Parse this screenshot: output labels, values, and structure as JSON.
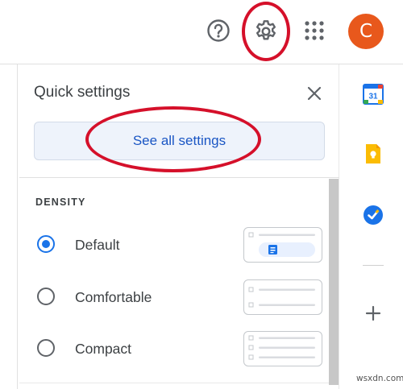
{
  "topbar": {
    "help_icon": "help-circle-icon",
    "settings_icon": "gear-icon",
    "apps_icon": "apps-grid-icon",
    "avatar_letter": "C",
    "avatar_color": "#e8581c"
  },
  "quick_settings": {
    "title": "Quick settings",
    "close_icon": "close-icon",
    "see_all_label": "See all settings",
    "density": {
      "heading": "DENSITY",
      "options": [
        {
          "label": "Default",
          "selected": true
        },
        {
          "label": "Comfortable",
          "selected": false
        },
        {
          "label": "Compact",
          "selected": false
        }
      ]
    }
  },
  "side_apps": {
    "calendar_day": "31",
    "icons": [
      "calendar-icon",
      "keep-icon",
      "tasks-icon",
      "add-icon"
    ]
  },
  "colors": {
    "accent_blue": "#1a73e8",
    "highlight_red": "#d5102a",
    "link_blue": "#1a56c4"
  },
  "watermark": "wsxdn.com"
}
